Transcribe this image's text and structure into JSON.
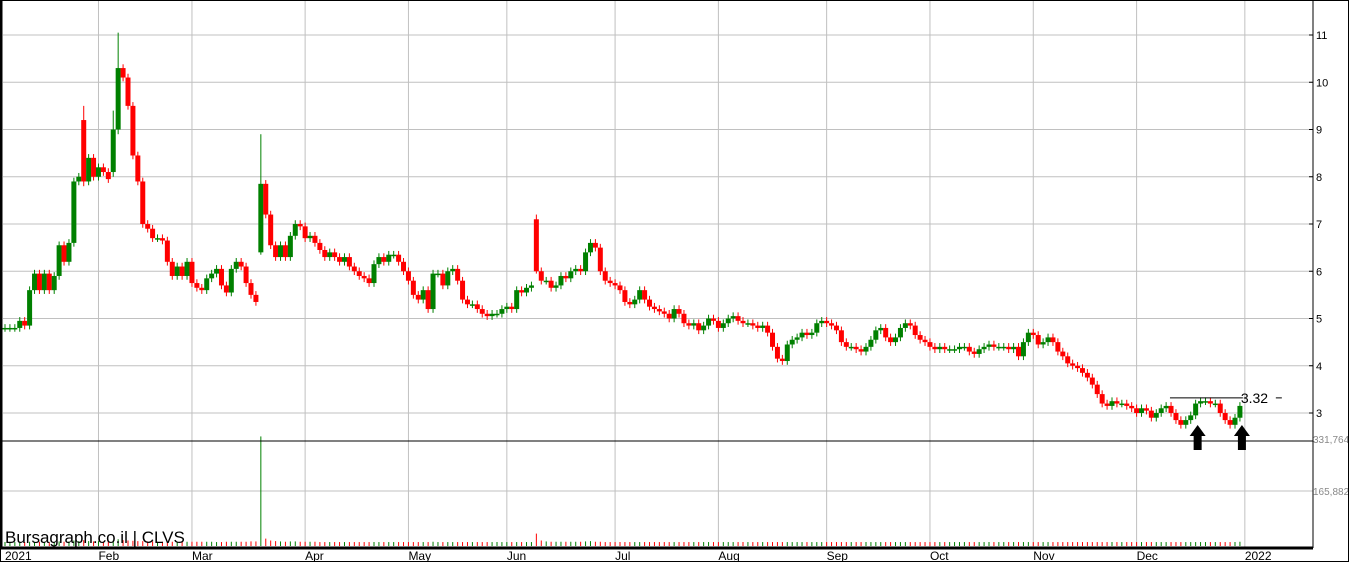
{
  "chart_data": {
    "type": "candlestick",
    "title": "Bursagraph.co.il | CLVS",
    "ticker": "CLVS",
    "price_ticks": [
      "3",
      "4",
      "5",
      "6",
      "7",
      "8",
      "9",
      "10",
      "11"
    ],
    "price_range": [
      2.4,
      11.7
    ],
    "volume_ticks": [
      "165,882",
      "331,764"
    ],
    "volume_tick_values": [
      165882,
      331764
    ],
    "months": [
      {
        "label": "2021",
        "index": 0
      },
      {
        "label": "Feb",
        "index": 19
      },
      {
        "label": "Mar",
        "index": 38
      },
      {
        "label": "Apr",
        "index": 61
      },
      {
        "label": "May",
        "index": 82
      },
      {
        "label": "Jun",
        "index": 102
      },
      {
        "label": "Jul",
        "index": 124
      },
      {
        "label": "Aug",
        "index": 145
      },
      {
        "label": "Sep",
        "index": 167
      },
      {
        "label": "Oct",
        "index": 188
      },
      {
        "label": "Nov",
        "index": 209
      },
      {
        "label": "Dec",
        "index": 230
      },
      {
        "label": "2022",
        "index": 252
      }
    ],
    "close": [
      4.8,
      4.8,
      4.8,
      4.95,
      4.85,
      5.6,
      5.95,
      5.6,
      5.95,
      5.6,
      5.9,
      6.55,
      6.2,
      6.6,
      7.9,
      8.0,
      7.9,
      8.4,
      8.0,
      8.2,
      8.1,
      7.95,
      9.0,
      10.3,
      10.1,
      9.5,
      8.45,
      7.9,
      7.0,
      6.9,
      6.7,
      6.7,
      6.65,
      6.2,
      5.9,
      6.1,
      5.9,
      6.2,
      5.75,
      5.65,
      5.6,
      5.85,
      5.95,
      6.05,
      5.7,
      5.55,
      6.05,
      6.2,
      6.1,
      5.75,
      5.5,
      5.35,
      7.85,
      7.2,
      6.55,
      6.3,
      6.55,
      6.3,
      6.75,
      7.0,
      6.95,
      6.7,
      6.75,
      6.6,
      6.45,
      6.3,
      6.4,
      6.3,
      6.2,
      6.3,
      6.1,
      6.0,
      5.9,
      5.85,
      5.75,
      6.15,
      6.3,
      6.2,
      6.35,
      6.35,
      6.2,
      6.0,
      5.8,
      5.5,
      5.4,
      5.6,
      5.2,
      5.95,
      5.95,
      5.7,
      6.0,
      6.05,
      5.8,
      5.4,
      5.3,
      5.3,
      5.2,
      5.1,
      5.05,
      5.1,
      5.1,
      5.2,
      5.25,
      5.2,
      5.6,
      5.55,
      5.65,
      5.7,
      6.0,
      5.8,
      5.8,
      5.65,
      5.7,
      5.9,
      5.85,
      6.0,
      6.05,
      6.0,
      6.4,
      6.6,
      6.5,
      6.0,
      5.8,
      5.75,
      5.7,
      5.6,
      5.35,
      5.3,
      5.4,
      5.6,
      5.4,
      5.25,
      5.2,
      5.15,
      5.1,
      5.0,
      5.2,
      5.1,
      4.9,
      4.85,
      4.9,
      4.75,
      4.85,
      5.0,
      4.95,
      4.8,
      4.9,
      5.0,
      5.05,
      4.95,
      4.9,
      4.9,
      4.85,
      4.8,
      4.85,
      4.7,
      4.4,
      4.15,
      4.1,
      4.45,
      4.55,
      4.6,
      4.7,
      4.65,
      4.7,
      4.9,
      4.95,
      4.9,
      4.85,
      4.75,
      4.5,
      4.4,
      4.4,
      4.35,
      4.3,
      4.4,
      4.55,
      4.75,
      4.8,
      4.6,
      4.5,
      4.6,
      4.8,
      4.9,
      4.85,
      4.65,
      4.55,
      4.5,
      4.4,
      4.35,
      4.4,
      4.35,
      4.35,
      4.35,
      4.4,
      4.4,
      4.3,
      4.25,
      4.35,
      4.4,
      4.45,
      4.4,
      4.4,
      4.4,
      4.35,
      4.4,
      4.2,
      4.5,
      4.7,
      4.65,
      4.45,
      4.5,
      4.6,
      4.5,
      4.3,
      4.2,
      4.05,
      4.0,
      3.95,
      3.85,
      3.75,
      3.6,
      3.4,
      3.2,
      3.15,
      3.25,
      3.2,
      3.2,
      3.15,
      3.1,
      3.0,
      3.1,
      3.05,
      2.9,
      3.0,
      3.1,
      3.15,
      3.0,
      2.85,
      2.75,
      2.85,
      2.95,
      3.2,
      3.25,
      3.25,
      3.2,
      3.2,
      3.0,
      2.85,
      2.75,
      2.9,
      3.15
    ],
    "overrides": [
      {
        "index": 16,
        "open": 9.2,
        "high": 9.5,
        "low": 7.8
      },
      {
        "index": 22,
        "open": 8.1,
        "high": 9.4,
        "low": 8.0
      },
      {
        "index": 23,
        "open": 9.0,
        "high": 11.05,
        "low": 8.9
      },
      {
        "index": 52,
        "open": 6.4,
        "high": 8.9,
        "low": 6.35
      },
      {
        "index": 108,
        "open": 7.1,
        "high": 7.2,
        "low": 5.95
      }
    ],
    "volume_thousands": [
      3,
      3,
      3,
      3,
      3,
      4,
      4,
      4,
      4,
      3,
      4,
      5,
      4,
      5,
      8,
      6,
      9,
      6,
      5,
      6,
      5,
      5,
      8,
      12,
      9,
      8,
      7,
      6,
      6,
      5,
      5,
      4,
      4,
      5,
      4,
      4,
      4,
      4,
      4,
      4,
      4,
      4,
      4,
      3,
      3,
      4,
      4,
      4,
      4,
      4,
      5,
      5,
      340,
      14,
      8,
      6,
      5,
      4,
      5,
      5,
      4,
      4,
      4,
      4,
      3,
      3,
      3,
      3,
      3,
      3,
      3,
      3,
      3,
      3,
      3,
      3,
      3,
      3,
      3,
      3,
      3,
      3,
      3,
      3,
      3,
      3,
      3,
      4,
      3,
      3,
      3,
      3,
      3,
      3,
      3,
      3,
      3,
      3,
      3,
      3,
      3,
      3,
      3,
      3,
      3,
      3,
      3,
      3,
      30,
      8,
      5,
      4,
      4,
      4,
      4,
      4,
      4,
      4,
      5,
      6,
      4,
      4,
      3,
      3,
      3,
      3,
      3,
      3,
      3,
      3,
      3,
      3,
      3,
      3,
      3,
      3,
      3,
      3,
      3,
      3,
      3,
      3,
      3,
      3,
      3,
      3,
      3,
      3,
      3,
      3,
      3,
      3,
      3,
      3,
      3,
      3,
      3,
      3,
      3,
      3,
      3,
      3,
      3,
      3,
      3,
      3,
      3,
      3,
      3,
      3,
      3,
      3,
      3,
      3,
      3,
      3,
      3,
      3,
      3,
      3,
      3,
      3,
      3,
      3,
      3,
      3,
      3,
      3,
      3,
      3,
      3,
      3,
      3,
      3,
      3,
      3,
      3,
      3,
      3,
      3,
      3,
      3,
      3,
      3,
      3,
      3,
      3,
      3,
      3,
      3,
      3,
      3,
      3,
      3,
      3,
      3,
      3,
      3,
      3,
      3,
      3,
      3,
      3,
      3,
      3,
      3,
      3,
      3,
      3,
      3,
      3,
      3,
      3,
      3,
      3,
      3,
      3,
      3,
      3,
      3,
      3,
      3,
      3,
      3,
      3,
      3,
      3,
      3,
      3,
      3,
      3,
      4
    ],
    "resistance": {
      "value": 3.32,
      "label": "3.32",
      "from_index": 238
    },
    "signal_arrows_index": [
      242,
      251
    ],
    "colors": {
      "up": "#008000",
      "down": "#ff0000",
      "grid": "#c0c0c0"
    }
  }
}
